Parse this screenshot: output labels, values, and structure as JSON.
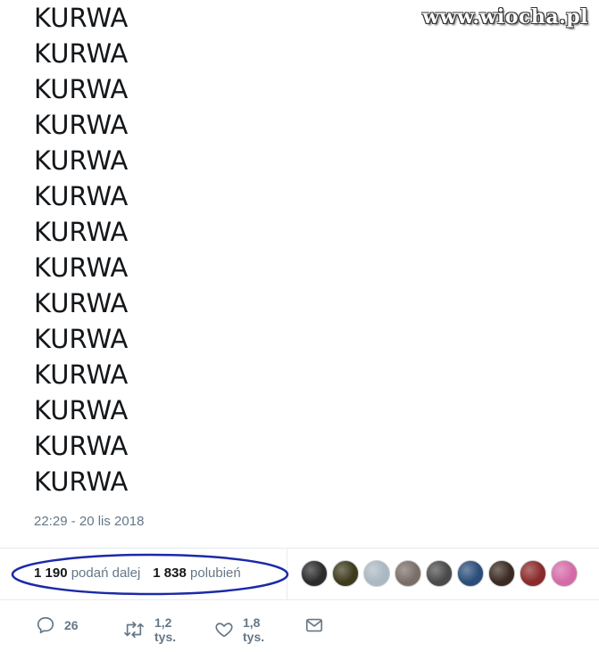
{
  "watermark": "www.wiocha.pl",
  "tweet": {
    "lines": [
      "KURWA",
      "KURWA",
      "KURWA",
      "KURWA",
      "KURWA",
      "KURWA",
      "KURWA",
      "KURWA",
      "KURWA",
      "KURWA",
      "KURWA",
      "KURWA",
      "KURWA",
      "KURWA"
    ],
    "timestamp": "22:29 - 20 lis 2018"
  },
  "stats": {
    "retweets_count": "1 190",
    "retweets_label": "podań dalej",
    "likes_count": "1 838",
    "likes_label": "polubień",
    "highlight_color": "#1b2aa8"
  },
  "avatars": [
    {
      "icon": "avatar-dark-icon",
      "color": "#2b2b2b"
    },
    {
      "icon": "avatar-portrait-icon",
      "color": "#3e3a1c"
    },
    {
      "icon": "avatar-default-icon",
      "color": "#aab8c2"
    },
    {
      "icon": "avatar-photo-icon",
      "color": "#7a6e68"
    },
    {
      "icon": "avatar-dog-icon",
      "color": "#4a4a4a"
    },
    {
      "icon": "avatar-blue-icon",
      "color": "#2a4d7a"
    },
    {
      "icon": "avatar-person-icon",
      "color": "#3a2a22"
    },
    {
      "icon": "avatar-flag-icon",
      "color": "#8a2a2a"
    },
    {
      "icon": "avatar-pink-icon",
      "color": "#d56aa8"
    }
  ],
  "actions": {
    "reply_count": "26",
    "retweet_count": "1,2 tys.",
    "like_count": "1,8 tys."
  },
  "colors": {
    "text": "#14171a",
    "muted": "#657786"
  }
}
